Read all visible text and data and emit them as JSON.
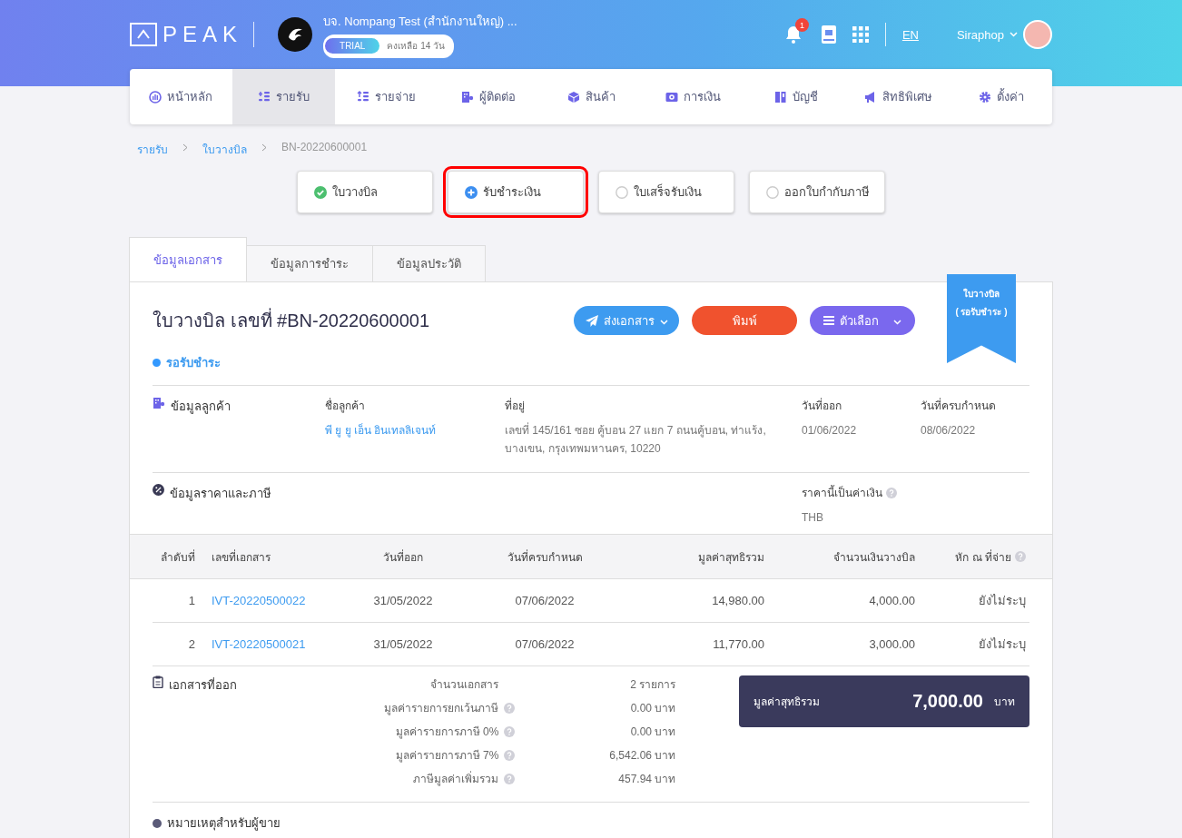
{
  "header": {
    "logo": "PEAK",
    "company": "บจ. Nompang Test (สำนักงานใหญ่) ...",
    "trial_badge": "TRIAL",
    "trial_remaining": "คงเหลือ 14 วัน",
    "notification_count": "1",
    "language": "EN",
    "user": "Siraphop"
  },
  "nav": [
    {
      "label": "หน้าหลัก",
      "selected": false
    },
    {
      "label": "รายรับ",
      "selected": true
    },
    {
      "label": "รายจ่าย",
      "selected": false
    },
    {
      "label": "ผู้ติดต่อ",
      "selected": false
    },
    {
      "label": "สินค้า",
      "selected": false
    },
    {
      "label": "การเงิน",
      "selected": false
    },
    {
      "label": "บัญชี",
      "selected": false
    },
    {
      "label": "สิทธิพิเศษ",
      "selected": false
    },
    {
      "label": "ตั้งค่า",
      "selected": false
    }
  ],
  "breadcrumb": [
    {
      "label": "รายรับ",
      "link": true
    },
    {
      "label": "ใบวางบิล",
      "link": true
    },
    {
      "label": "BN-20220600001",
      "link": false
    }
  ],
  "steps": [
    {
      "label": "ใบวางบิล",
      "kind": "done",
      "highlighted": false
    },
    {
      "label": "รับชำระเงิน",
      "kind": "current",
      "highlighted": true
    },
    {
      "label": "ใบเสร็จรับเงิน",
      "kind": "pending",
      "highlighted": false
    },
    {
      "label": "ออกใบกำกับภาษี",
      "kind": "pending",
      "highlighted": false
    }
  ],
  "tabs": [
    {
      "label": "ข้อมูลเอกสาร",
      "selected": true
    },
    {
      "label": "ข้อมูลการชำระ",
      "selected": false
    },
    {
      "label": "ข้อมูลประวัติ",
      "selected": false
    }
  ],
  "document": {
    "title": "ใบวางบิล เลขที่ #BN-20220600001",
    "status": "รอรับชำระ",
    "buttons": [
      {
        "label": "ส่งเอกสาร",
        "kind": "send"
      },
      {
        "label": "พิมพ์",
        "kind": "print"
      },
      {
        "label": "ตัวเลือก",
        "kind": "options"
      }
    ],
    "ribbon": [
      "ใบวางบิล",
      "( รอรับชำระ )"
    ]
  },
  "customer": {
    "heading": "ข้อมูลลูกค้า",
    "fields": [
      {
        "label": "ชื่อลูกค้า",
        "value": "พี ยู ยู เอ็น อินเทลลิเจนท์",
        "kind": "link"
      },
      {
        "label": "ที่อยู่",
        "value": "เลขที่ 145/161 ซอย คู้บอน 27 แยก 7 ถนนคู้บอน, ท่าแร้ง, บางเขน, กรุงเทพมหานคร, 10220",
        "kind": "text"
      },
      {
        "label": "วันที่ออก",
        "value": "01/06/2022",
        "kind": "text"
      },
      {
        "label": "วันที่ครบกำหนด",
        "value": "08/06/2022",
        "kind": "text"
      }
    ]
  },
  "pricing": {
    "heading": "ข้อมูลราคาและภาษี",
    "currency_label": "ราคานี้เป็นค่าเงิน",
    "currency": "THB"
  },
  "table": {
    "columns": [
      {
        "label": "ลำดับที่",
        "help": false
      },
      {
        "label": "เลขที่เอกสาร",
        "help": false
      },
      {
        "label": "วันที่ออก",
        "help": false
      },
      {
        "label": "วันที่ครบกำหนด",
        "help": false
      },
      {
        "label": "มูลค่าสุทธิรวม",
        "help": false
      },
      {
        "label": "จำนวนเงินวางบิล",
        "help": false
      },
      {
        "label": "หัก ณ ที่จ่าย",
        "help": true
      }
    ],
    "rows": [
      [
        "1",
        "IVT-20220500022",
        "31/05/2022",
        "07/06/2022",
        "14,980.00",
        "4,000.00",
        "ยังไม่ระบุ"
      ],
      [
        "2",
        "IVT-20220500021",
        "31/05/2022",
        "07/06/2022",
        "11,770.00",
        "3,000.00",
        "ยังไม่ระบุ"
      ]
    ]
  },
  "summary": {
    "heading": "เอกสารที่ออก",
    "lines": [
      {
        "label": "จำนวนเอกสาร",
        "value": "2 รายการ",
        "help": false
      },
      {
        "label": "มูลค่ารายการยกเว้นภาษี",
        "value": "0.00 บาท",
        "help": true
      },
      {
        "label": "มูลค่ารายการภาษี 0%",
        "value": "0.00 บาท",
        "help": true
      },
      {
        "label": "มูลค่ารายการภาษี 7%",
        "value": "6,542.06 บาท",
        "help": true
      },
      {
        "label": "ภาษีมูลค่าเพิ่มรวม",
        "value": "457.94 บาท",
        "help": true
      }
    ],
    "total_label": "มูลค่าสุทธิรวม",
    "total": "7,000.00",
    "total_unit": "บาท"
  },
  "notes": {
    "heading": "หมายเหตุสำหรับผู้ขาย"
  }
}
